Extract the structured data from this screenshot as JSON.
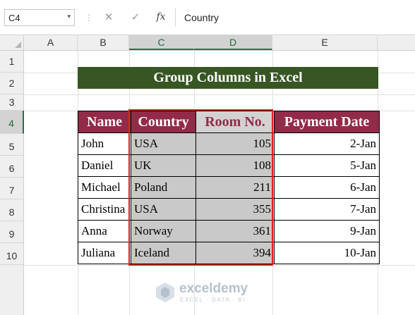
{
  "formula_bar": {
    "name_box": "C4",
    "name_box_caret": "▾",
    "separator": "⋮",
    "cancel_glyph": "✕",
    "enter_glyph": "✓",
    "fx_label": "fx",
    "content": "Country"
  },
  "columns": [
    "A",
    "B",
    "C",
    "D",
    "E"
  ],
  "selected_columns": [
    "C",
    "D"
  ],
  "rows": [
    "1",
    "2",
    "3",
    "4",
    "5",
    "6",
    "7",
    "8",
    "9",
    "10"
  ],
  "selected_rows": [
    "4"
  ],
  "sheet": {
    "title": "Group Columns in Excel",
    "headers": [
      "Name",
      "Country",
      "Room No.",
      "Payment Date"
    ],
    "records": [
      [
        "John",
        "USA",
        "105",
        "2-Jan"
      ],
      [
        "Daniel",
        "UK",
        "108",
        "5-Jan"
      ],
      [
        "Michael",
        "Poland",
        "211",
        "6-Jan"
      ],
      [
        "Christina",
        "USA",
        "355",
        "7-Jan"
      ],
      [
        "Anna",
        "Norway",
        "361",
        "9-Jan"
      ],
      [
        "Juliana",
        "Iceland",
        "394",
        "10-Jan"
      ]
    ]
  },
  "watermark": {
    "name": "exceldemy",
    "tagline": "EXCEL · DATA · BI"
  },
  "colors": {
    "title_fill": "#375623",
    "header_fill": "#922b48",
    "grouped_fill": "#c9c9c9",
    "highlight_border": "#e02020",
    "selection_accent": "#217346"
  }
}
